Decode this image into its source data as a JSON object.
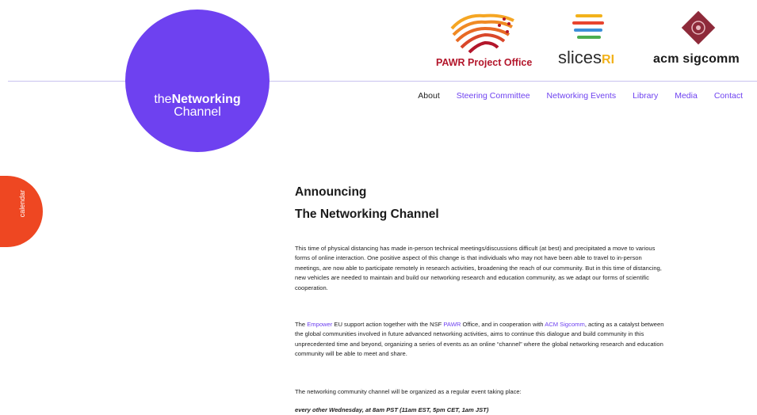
{
  "sponsors": {
    "pawr": "PAWR Project Office",
    "slices_main": "slices",
    "slices_ri": "RI",
    "acm": "acm sigcomm"
  },
  "brand": {
    "prefix": "the",
    "bold": "Networking",
    "line2": "Channel"
  },
  "nav": {
    "about": "About",
    "steering": "Steering Committee",
    "events": "Networking Events",
    "library": "Library",
    "media": "Media",
    "contact": "Contact"
  },
  "calendar_tab": "calendar",
  "article": {
    "heading1": "Announcing",
    "heading2": "The Networking Channel",
    "p1": "This time of physical distancing has made in-person technical meetings/discussions difficult (at best) and precipitated a move to various forms of online interaction. One positive aspect of this change is that individuals who may not have been able to travel to in-person meetings, are now able to participate remotely in research activities, broadening the reach of our community. But in this time of distancing, new vehicles are needed to maintain and build our networking research and education community, as we adapt our forms of scientific cooperation.",
    "p2": {
      "t1": "The ",
      "link1": "Empower",
      "t2": " EU support action together with the NSF ",
      "link2": "PAWR",
      "t3": " Office, and in cooperation with ",
      "link3": "ACM Sigcomm",
      "t4": ", acting as a catalyst between the global communities involved in future advanced networking activities, aims to continue this dialogue and build community in this unprecedented time and beyond, organizing a series of events as an online “channel” where the global networking research and education community will be able to meet and share."
    },
    "p3": "The networking community channel will be organized as a regular event taking place:",
    "p4": "every other Wednesday, at 8am PST (11am EST, 5pm CET, 1am JST)"
  },
  "colors": {
    "brand_purple": "#6e41f0",
    "calendar_orange": "#ee4722",
    "pawr_red": "#b3162b",
    "slices_yellow": "#f2b21b"
  }
}
